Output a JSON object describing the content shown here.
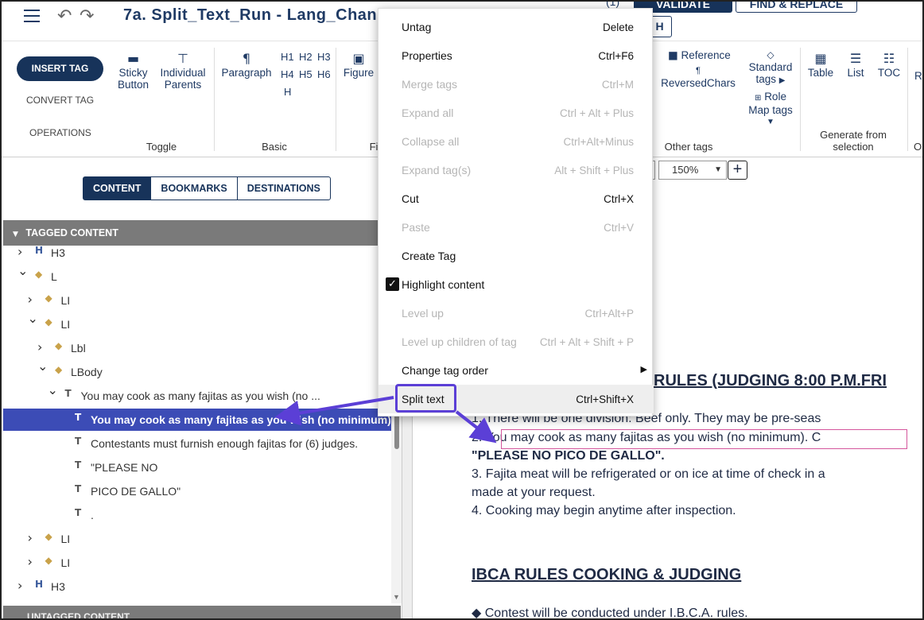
{
  "topbar": {
    "title": "7a. Split_Text_Run - Lang_Chan",
    "count": "(1)",
    "validate_label": "VALIDATE",
    "find_replace_label": "FIND & REPLACE",
    "h_button": "H"
  },
  "ribbon": {
    "insert_tag": "INSERT TAG",
    "convert_tag": "CONVERT TAG",
    "operations": "OPERATIONS",
    "sticky_button": "Sticky\nButton",
    "individual_parents": "Individual\nParents",
    "toggle_label": "Toggle",
    "paragraph": "Paragraph",
    "headings": [
      "H1",
      "H2",
      "H3",
      "H4",
      "H5",
      "H6",
      "H"
    ],
    "basic_label": "Basic",
    "figure": "Figure",
    "figure_group_partial": "Fi",
    "reference": "Reference",
    "reversed_chars": "ReversedChars",
    "other_tags_label": "Other tags",
    "standard_tags": "Standard\ntags",
    "role_map_tags": "Role\nMap tags",
    "table": "Table",
    "list": "List",
    "toc": "TOC",
    "partial_r": "R",
    "generate_label": "Generate from\nselection",
    "partial_o": "O"
  },
  "left_panel": {
    "tabs": [
      {
        "label": "CONTENT",
        "active": true
      },
      {
        "label": "BOOKMARKS",
        "active": false
      },
      {
        "label": "DESTINATIONS",
        "active": false
      }
    ],
    "tagged_header": "TAGGED CONTENT",
    "untagged_header": "UNTAGGED CONTENT",
    "tree": [
      {
        "label": "H3",
        "icon": "heading",
        "chev": "right",
        "indent": 0
      },
      {
        "label": "L",
        "icon": "tag",
        "chev": "down",
        "indent": 0
      },
      {
        "label": "LI",
        "icon": "tag",
        "chev": "right",
        "indent": 1
      },
      {
        "label": "LI",
        "icon": "tag",
        "chev": "down",
        "indent": 1
      },
      {
        "label": "Lbl",
        "icon": "tag",
        "chev": "right",
        "indent": 2
      },
      {
        "label": "LBody",
        "icon": "tag",
        "chev": "down",
        "indent": 2
      },
      {
        "label": "You may cook as many fajitas as you wish (no ...",
        "icon": "text-run",
        "chev": "down",
        "indent": 3
      },
      {
        "label": "You may cook as many fajitas as you wish (no minimum).",
        "icon": "text",
        "chev": "none",
        "indent": 4,
        "selected": true
      },
      {
        "label": "Contestants must furnish enough fajitas for (6) judges.",
        "icon": "text",
        "chev": "none",
        "indent": 4
      },
      {
        "label": "\"PLEASE NO",
        "icon": "text",
        "chev": "none",
        "indent": 4
      },
      {
        "label": "PICO DE GALLO\"",
        "icon": "text",
        "chev": "none",
        "indent": 4
      },
      {
        "label": ".",
        "icon": "text",
        "chev": "none",
        "indent": 4
      },
      {
        "label": "LI",
        "icon": "tag",
        "chev": "right",
        "indent": 1
      },
      {
        "label": "LI",
        "icon": "tag",
        "chev": "right",
        "indent": 1
      },
      {
        "label": "H3",
        "icon": "heading",
        "chev": "right",
        "indent": 0
      }
    ]
  },
  "viewer": {
    "zoom": "150%",
    "lines": [
      {
        "text": "RULES (JUDGING 8:00 P.M.FRI",
        "style": "heading"
      },
      {
        "text": "1.   There will be one division: Beef only. They may be pre-seas",
        "style": "normal"
      },
      {
        "text": "2.    You may cook as many fajitas as you wish (no minimum).  C",
        "style": "normal"
      },
      {
        "text": "\"PLEASE NO PICO DE GALLO\".",
        "style": "bold"
      },
      {
        "text": "3.    Fajita meat will be refrigerated or on ice at time of check in a",
        "style": "normal"
      },
      {
        "text": "made at            your request.",
        "style": "normal"
      },
      {
        "text": " 4.   Cooking may begin anytime after inspection.",
        "style": "normal"
      },
      {
        "text": "IBCA RULES COOKING & JUDGING",
        "style": "heading"
      },
      {
        "text": "◆    Contest will be conducted under I.B.C.A. rules.",
        "style": "normal"
      }
    ]
  },
  "context_menu": {
    "items": [
      {
        "label": "Untag",
        "shortcut": "Delete",
        "disabled": false
      },
      {
        "label": "Properties",
        "shortcut": "Ctrl+F6",
        "disabled": false
      },
      {
        "label": "Merge tags",
        "shortcut": "Ctrl+M",
        "disabled": true
      },
      {
        "label": "Expand all",
        "shortcut": "Ctrl + Alt + Plus",
        "disabled": true
      },
      {
        "label": "Collapse all",
        "shortcut": "Ctrl+Alt+Minus",
        "disabled": true
      },
      {
        "label": "Expand tag(s)",
        "shortcut": "Alt + Shift + Plus",
        "disabled": true
      },
      {
        "label": "Cut",
        "shortcut": "Ctrl+X",
        "disabled": false
      },
      {
        "label": "Paste",
        "shortcut": "Ctrl+V",
        "disabled": true
      },
      {
        "label": "Create Tag",
        "shortcut": "",
        "disabled": false
      },
      {
        "label": "Highlight content",
        "shortcut": "",
        "disabled": false,
        "checked": true
      },
      {
        "label": "Level up",
        "shortcut": "Ctrl+Alt+P",
        "disabled": true
      },
      {
        "label": "Level up children of tag",
        "shortcut": "Ctrl + Alt + Shift + P",
        "disabled": true
      },
      {
        "label": "Change tag order",
        "shortcut": "",
        "disabled": false,
        "submenu": true
      },
      {
        "label": "Split text",
        "shortcut": "Ctrl+Shift+X",
        "disabled": false,
        "hover": true
      }
    ]
  },
  "colors": {
    "primary": "#17335a",
    "selection": "#3c4cb6",
    "annotation_purple": "#5b3fd6",
    "highlight_pink": "#d4569c"
  }
}
